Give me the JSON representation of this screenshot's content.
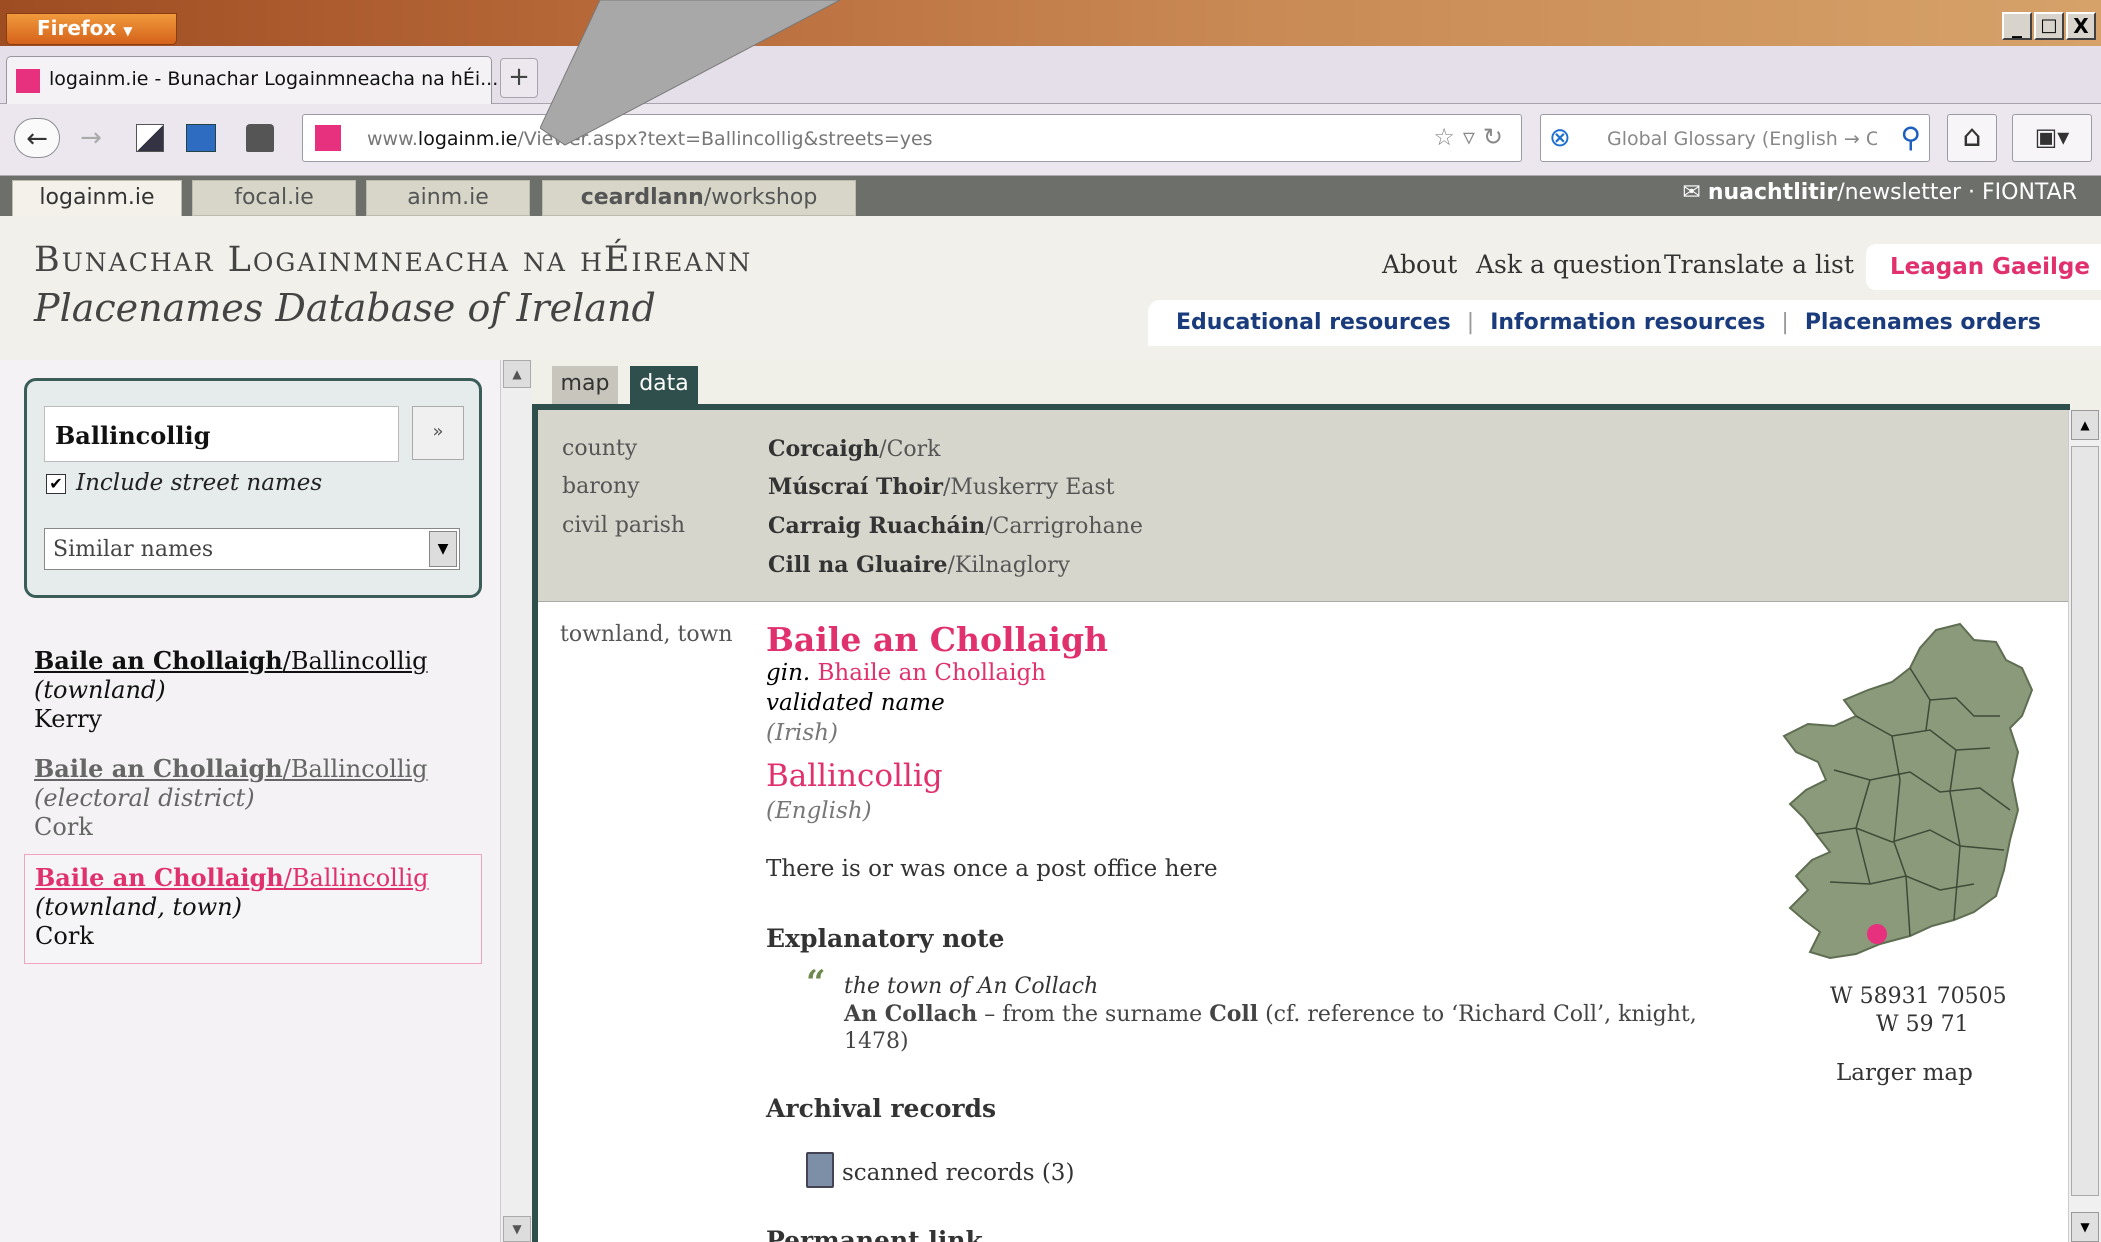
{
  "browser": {
    "app_button": "Firefox",
    "window_controls": [
      "_",
      "□",
      "X"
    ],
    "tab_title": "logainm.ie - Bunachar Logainmneacha na hÉi...",
    "new_tab": "+",
    "url_host_prefix": "www.",
    "url_host": "logainm.ie",
    "url_path": "/Viewer.aspx?text=Ballincollig&streets=yes",
    "search_placeholder": "Global Glossary (English → Cz"
  },
  "site_tabs": [
    "logainm.ie",
    "focal.ie",
    "ainm.ie"
  ],
  "workshop_tab": {
    "bold": "ceardlann",
    "rest": "/workshop"
  },
  "newsletter": {
    "bold": "nuachtlitir",
    "rest": "/newsletter",
    "org": " · FIONTAR"
  },
  "header": {
    "title_irish": "Bunachar Logainmneacha na hÉireann",
    "title_english": "Placenames Database of Ireland",
    "links": [
      "About",
      "Ask a question",
      "Translate a list"
    ],
    "language_switch": "Leagan Gaeilge",
    "resources": [
      "Educational resources",
      "Information resources",
      "Placenames orders"
    ]
  },
  "search": {
    "value": "Ballincollig",
    "go": "»",
    "include_streets_label": "Include street names",
    "include_streets_checked": true,
    "checkbox_mark": "✔",
    "similar_select": "Similar names"
  },
  "results": [
    {
      "irish": "Baile an Chollaigh",
      "english": "/Ballincollig",
      "type": "(townland)",
      "county": "Kerry"
    },
    {
      "irish": "Baile an Chollaigh",
      "english": "/Ballincollig",
      "type": "(electoral district)",
      "county": "Cork"
    },
    {
      "irish": "Baile an Chollaigh",
      "english": "/Ballincollig",
      "type": "(townland, town)",
      "county": "Cork"
    }
  ],
  "view_tabs": {
    "map": "map",
    "data": "data"
  },
  "admin": {
    "county_label": "county",
    "county_irish": "Corcaigh",
    "county_english": "/Cork",
    "barony_label": "barony",
    "barony_irish": "Múscraí Thoir",
    "barony_english": "/Muskerry East",
    "parish_label": "civil parish",
    "parish1_irish": "Carraig Ruacháin",
    "parish1_english": "/Carrigrohane",
    "parish2_irish": "Cill na Gluaire",
    "parish2_english": "/Kilnaglory"
  },
  "entry": {
    "type_label": "townland, town",
    "irish_name": "Baile an Chollaigh",
    "gen_prefix": "gin.",
    "gen_name": "Bhaile an Chollaigh",
    "validated": "validated name",
    "irish_lang": "(Irish)",
    "english_name": "Ballincollig",
    "english_lang": "(English)",
    "post_office": "There is or was once a post office here",
    "explanatory_heading": "Explanatory note",
    "quote_mark": "“",
    "note_line1": "the town of An Collach",
    "note_term": "An Collach",
    "note_text1": " – from the surname ",
    "note_surname": "Coll",
    "note_text2": " (cf. reference to ‘Richard Coll’, knight,",
    "note_text3": "1478)",
    "archival_heading": "Archival records",
    "scanned_records": "scanned records (3)",
    "permanent_link": "Permanent link"
  },
  "map": {
    "grid_ref_1": "W 58931 70505",
    "grid_ref_2": "W 59 71",
    "larger_map": "Larger map"
  },
  "colors": {
    "accent": "#e0306e",
    "frame": "#2f4f4c",
    "admin_bg": "#d7d6cc",
    "link_blue": "#1a3b7c"
  }
}
